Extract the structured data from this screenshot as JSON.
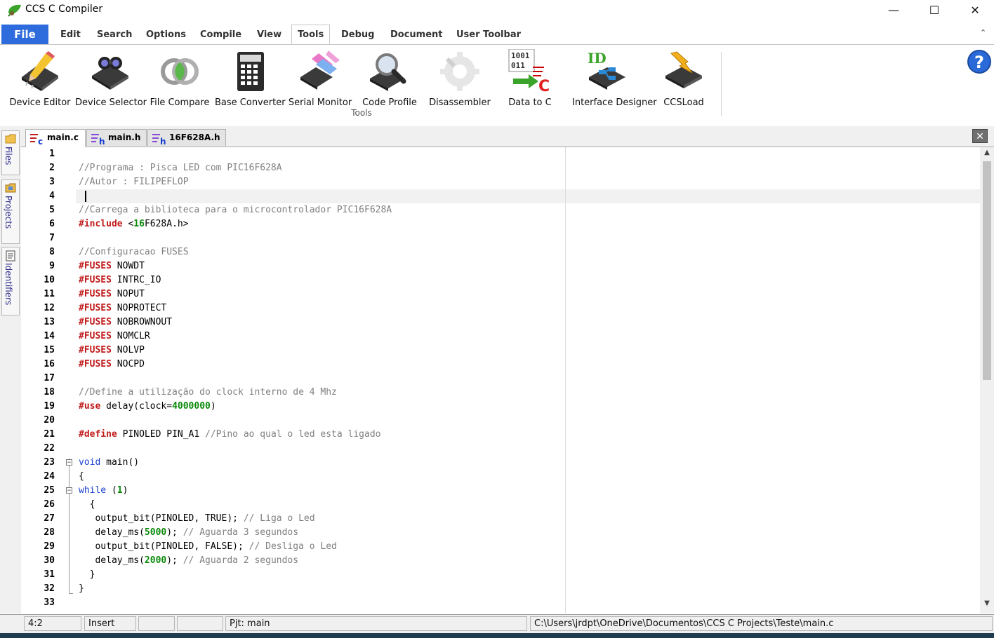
{
  "window": {
    "title": "CCS C Compiler",
    "controls": {
      "minimize": "—",
      "maximize": "☐",
      "close": "✕"
    }
  },
  "menu": {
    "file": "File",
    "items": [
      "Edit",
      "Search",
      "Options",
      "Compile",
      "View",
      "Tools",
      "Debug",
      "Document",
      "User Toolbar"
    ],
    "active": "Tools",
    "collapse_icon": "⌃"
  },
  "ribbon": {
    "group_label": "Tools",
    "tools": [
      {
        "label": "Device Editor",
        "icon": "device-editor-icon"
      },
      {
        "label": "Device Selector",
        "icon": "device-selector-icon"
      },
      {
        "label": "File Compare",
        "icon": "file-compare-icon"
      },
      {
        "label": "Base Converter",
        "icon": "base-converter-icon"
      },
      {
        "label": "Serial Monitor",
        "icon": "serial-monitor-icon"
      },
      {
        "label": "Code Profile",
        "icon": "code-profile-icon"
      },
      {
        "label": "Disassembler",
        "icon": "disassembler-icon"
      },
      {
        "label": "Data to C",
        "icon": "data-to-c-icon",
        "icon_text": [
          "1001",
          "011"
        ]
      },
      {
        "label": "Interface Designer",
        "icon": "interface-designer-icon",
        "icon_text": [
          "ID"
        ]
      },
      {
        "label": "CCSLoad",
        "icon": "ccsload-icon"
      }
    ],
    "help": "?"
  },
  "side_tabs": [
    "Files",
    "Projects",
    "Identifiers"
  ],
  "doc_tabs": [
    {
      "label": "main.c",
      "active": true,
      "icon_letter": "c"
    },
    {
      "label": "main.h",
      "active": false,
      "icon_letter": "h"
    },
    {
      "label": "16F628A.h",
      "active": false,
      "icon_letter": "h"
    }
  ],
  "close_doc": "✕",
  "editor": {
    "current_line": 4,
    "lines": [
      [],
      [
        [
          "c",
          "//Programa : Pisca LED com PIC16F628A"
        ]
      ],
      [
        [
          "c",
          "//Autor : FILIPEFLOP"
        ]
      ],
      [],
      [
        [
          "c",
          "//Carrega a biblioteca para o microcontrolador PIC16F628A"
        ]
      ],
      [
        [
          "d",
          "#include"
        ],
        [
          "p",
          " <"
        ],
        [
          "n",
          "16"
        ],
        [
          "p",
          "F628A.h>"
        ]
      ],
      [],
      [
        [
          "c",
          "//Configuracao FUSES"
        ]
      ],
      [
        [
          "d",
          "#FUSES"
        ],
        [
          "p",
          " NOWDT"
        ]
      ],
      [
        [
          "d",
          "#FUSES"
        ],
        [
          "p",
          " INTRC_IO"
        ]
      ],
      [
        [
          "d",
          "#FUSES"
        ],
        [
          "p",
          " NOPUT"
        ]
      ],
      [
        [
          "d",
          "#FUSES"
        ],
        [
          "p",
          " NOPROTECT"
        ]
      ],
      [
        [
          "d",
          "#FUSES"
        ],
        [
          "p",
          " NOBROWNOUT"
        ]
      ],
      [
        [
          "d",
          "#FUSES"
        ],
        [
          "p",
          " NOMCLR"
        ]
      ],
      [
        [
          "d",
          "#FUSES"
        ],
        [
          "p",
          " NOLVP"
        ]
      ],
      [
        [
          "d",
          "#FUSES"
        ],
        [
          "p",
          " NOCPD"
        ]
      ],
      [],
      [
        [
          "c",
          "//Define a utilização do clock interno de 4 Mhz"
        ]
      ],
      [
        [
          "d",
          "#use"
        ],
        [
          "p",
          " delay(clock="
        ],
        [
          "n",
          "4000000"
        ],
        [
          "p",
          ")"
        ]
      ],
      [],
      [
        [
          "d",
          "#define"
        ],
        [
          "p",
          " PINOLED PIN_A1 "
        ],
        [
          "c",
          "//Pino ao qual o led esta ligado"
        ]
      ],
      [],
      [
        [
          "k",
          "void"
        ],
        [
          "p",
          " main()"
        ]
      ],
      [
        [
          "p",
          "{"
        ]
      ],
      [
        [
          "k",
          "while"
        ],
        [
          "p",
          " ("
        ],
        [
          "n",
          "1"
        ],
        [
          "p",
          ")"
        ]
      ],
      [
        [
          "p",
          "  {"
        ]
      ],
      [
        [
          "p",
          "   output_bit(PINOLED, TRUE); "
        ],
        [
          "c",
          "// Liga o Led"
        ]
      ],
      [
        [
          "p",
          "   delay_ms("
        ],
        [
          "n",
          "5000"
        ],
        [
          "p",
          "); "
        ],
        [
          "c",
          "// Aguarda 3 segundos"
        ]
      ],
      [
        [
          "p",
          "   output_bit(PINOLED, FALSE); "
        ],
        [
          "c",
          "// Desliga o Led"
        ]
      ],
      [
        [
          "p",
          "   delay_ms("
        ],
        [
          "n",
          "2000"
        ],
        [
          "p",
          "); "
        ],
        [
          "c",
          "// Aguarda 2 segundos"
        ]
      ],
      [
        [
          "p",
          "  }"
        ]
      ],
      [
        [
          "p",
          "}"
        ]
      ],
      []
    ],
    "fold_markers": [
      {
        "line": 23,
        "symbol": "−"
      },
      {
        "line": 25,
        "symbol": "−"
      }
    ],
    "scroll": {
      "up": "▲",
      "down": "▼"
    }
  },
  "statusbar": {
    "position": "4:2",
    "mode": "Insert",
    "blank1": "",
    "blank2": "",
    "project": "Pjt: main",
    "path": "C:\\Users\\jrdpt\\OneDrive\\Documentos\\CCS C Projects\\Teste\\main.c"
  },
  "colors": {
    "accent_file": "#2e6bdc",
    "comment": "#808080",
    "directive": "#c11a1a",
    "number": "#0a8a0a",
    "keyword": "#1a3fd1"
  }
}
